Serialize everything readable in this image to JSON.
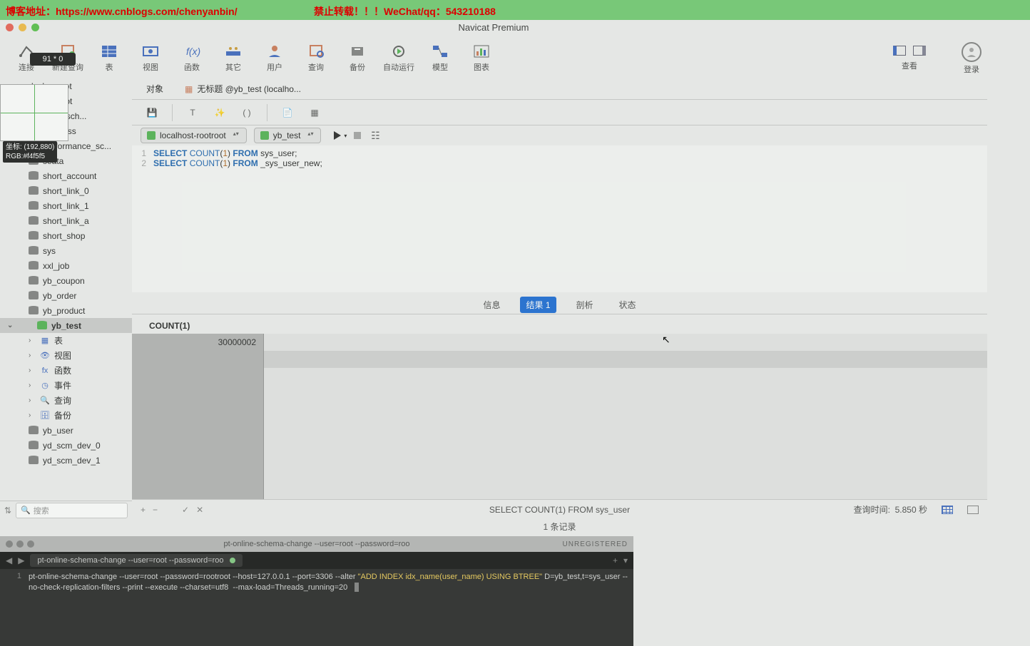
{
  "watermark": {
    "left": "博客地址：https://www.cnblogs.com/chenyanbin/",
    "right": "禁止转载！！！WeChat/qq：543210188"
  },
  "window": {
    "title": "Navicat Premium"
  },
  "toolbar": {
    "connect": "连接",
    "newquery": "新建查询",
    "table": "表",
    "view": "视图",
    "function": "函数",
    "other": "其它",
    "user": "用户",
    "query": "查询",
    "backup": "备份",
    "autorun": "自动运行",
    "model": "模型",
    "chart": "图表",
    "viewlabel": "查看",
    "login": "登录"
  },
  "tabs": {
    "objects": "对象",
    "query_tab": "无标题 @yb_test (localho..."
  },
  "overlay": {
    "badge": "91 * 0",
    "coords": "坐标:   (192,880)",
    "rgb": "RGB:#f4f5f5"
  },
  "combo": {
    "connection": "localhost-rootroot",
    "database": "yb_test"
  },
  "sql": {
    "l1": "1",
    "l2": "2",
    "select": "SELECT",
    "count": "COUNT",
    "one": "1",
    "from": "FROM",
    "t1": "sys_user",
    "t2": "_sys_user_new"
  },
  "result_tabs": {
    "info": "信息",
    "result": "结果 1",
    "analyze": "剖析",
    "status": "状态"
  },
  "result": {
    "header": "COUNT(1)",
    "value": "30000002"
  },
  "sidebar": {
    "root": "docker-root",
    "items": [
      "rootroot",
      "ation_sch...",
      "_ybclass",
      "performance_sc...",
      "seata",
      "short_account",
      "short_link_0",
      "short_link_1",
      "short_link_a",
      "short_shop",
      "sys",
      "xxl_job",
      "yb_coupon",
      "yb_order",
      "yb_product"
    ],
    "selected": "yb_test",
    "subs": [
      "表",
      "视图",
      "函数",
      "事件",
      "查询",
      "备份"
    ],
    "after": [
      "yb_user",
      "yd_scm_dev_0",
      "yd_scm_dev_1"
    ]
  },
  "search": {
    "placeholder": "搜索"
  },
  "status": {
    "query": "SELECT COUNT(1) FROM sys_user",
    "time_label": "查询时间:",
    "time": "5.850 秒",
    "records": "1 条记录"
  },
  "terminal": {
    "title": "pt-online-schema-change --user=root --password=roo",
    "unreg": "UNREGISTERED",
    "tab": "pt-online-schema-change --user=root --password=roo",
    "line_no": "1",
    "cmd_part1": "pt-online-schema-change --user=root --password=rootroot --host=127.0.0.1 --port=3306 --alter ",
    "cmd_str": "\"ADD INDEX idx_name(user_name) USING BTREE\"",
    "cmd_part2": " D=yb_test,t=sys_user --no-check-replication-filters --print --execute --charset=utf8  --max-load=Threads_running=20"
  }
}
